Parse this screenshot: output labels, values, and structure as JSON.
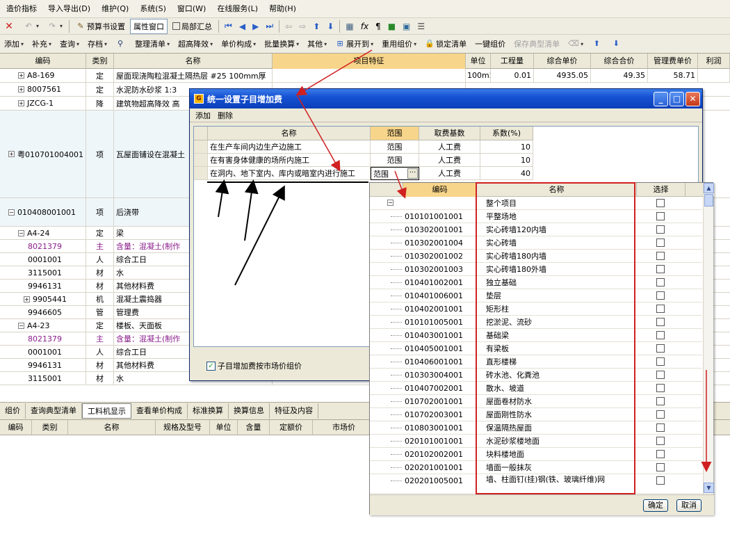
{
  "menu": [
    "造价指标",
    "导入导出(D)",
    "维护(Q)",
    "系统(S)",
    "窗口(W)",
    "在线服务(L)",
    "帮助(H)"
  ],
  "toolbar1": {
    "budget_settings": "预算书设置",
    "property_window": "属性窗口",
    "local_summary": "局部汇总"
  },
  "toolbar2": {
    "add": "添加",
    "supplement": "补充",
    "query": "查询",
    "store": "存档",
    "organize_list": "整理清单",
    "super_height": "超高降效",
    "unit_price_comp": "单价构成",
    "batch_convert": "批量换算",
    "other": "其他",
    "expand_to": "展开到",
    "reuse_price": "重用组价",
    "lock_list": "锁定清单",
    "one_key_price": "一键组价",
    "save_typical": "保存典型清单"
  },
  "main_grid": {
    "headers": [
      "编码",
      "类别",
      "名称",
      "项目特征",
      "单位",
      "工程量",
      "综合单价",
      "综合合价",
      "管理费单价",
      "利润"
    ],
    "rows": [
      {
        "code": "A8-169",
        "type": "定",
        "name": "屋面现浇陶粒混凝土隔热层 #25 100mm厚",
        "unit": "100m2",
        "qty": "0.01",
        "price": "4935.05",
        "total": "49.35",
        "mgmt": "58.71"
      },
      {
        "code": "8007561",
        "type": "定",
        "name": "水泥防水砂浆 1:3",
        "unit": "",
        "qty": "",
        "price": "",
        "total": "",
        "mgmt": ""
      },
      {
        "code": "JZCG-1",
        "type": "降",
        "name": "建筑物超高降效 高",
        "unit": "",
        "qty": "",
        "price": "",
        "total": "",
        "mgmt": ""
      },
      {
        "code": "粤010701004001",
        "type": "项",
        "name": "瓦屋面铺设在混凝土",
        "unit": "",
        "qty": "",
        "price": "",
        "total": "",
        "mgmt": ""
      },
      {
        "code": "010408001001",
        "type": "项",
        "name": "后浇带",
        "unit": "",
        "qty": "",
        "price": "",
        "total": "",
        "mgmt": ""
      },
      {
        "code": "A4-24",
        "type": "定",
        "name": "梁",
        "unit": "",
        "qty": "",
        "price": "",
        "total": "",
        "mgmt": ""
      },
      {
        "code": "8021379",
        "type": "主",
        "name": "含量：混凝土(制作",
        "unit": "",
        "qty": "",
        "price": "",
        "total": "",
        "mgmt": ""
      },
      {
        "code": "0001001",
        "type": "人",
        "name": "综合工日",
        "unit": "",
        "qty": "",
        "price": "",
        "total": "",
        "mgmt": ""
      },
      {
        "code": "3115001",
        "type": "材",
        "name": "水",
        "unit": "",
        "qty": "",
        "price": "",
        "total": "",
        "mgmt": ""
      },
      {
        "code": "9946131",
        "type": "材",
        "name": "其他材料费",
        "unit": "",
        "qty": "",
        "price": "",
        "total": "",
        "mgmt": ""
      },
      {
        "code": "9905441",
        "type": "机",
        "name": "混凝土震捣器",
        "unit": "",
        "qty": "",
        "price": "",
        "total": "",
        "mgmt": ""
      },
      {
        "code": "9946605",
        "type": "管",
        "name": "管理费",
        "unit": "",
        "qty": "",
        "price": "",
        "total": "",
        "mgmt": ""
      },
      {
        "code": "A4-23",
        "type": "定",
        "name": "楼板、天面板",
        "unit": "",
        "qty": "",
        "price": "",
        "total": "",
        "mgmt": ""
      },
      {
        "code": "8021379",
        "type": "主",
        "name": "含量：混凝土(制作",
        "unit": "",
        "qty": "",
        "price": "",
        "total": "",
        "mgmt": ""
      },
      {
        "code": "0001001",
        "type": "人",
        "name": "综合工日",
        "unit": "",
        "qty": "",
        "price": "",
        "total": "",
        "mgmt": ""
      },
      {
        "code": "9946131",
        "type": "材",
        "name": "其他材料费",
        "unit": "",
        "qty": "",
        "price": "",
        "total": "",
        "mgmt": ""
      },
      {
        "code": "3115001",
        "type": "材",
        "name": "水",
        "unit": "",
        "qty": "",
        "price": "",
        "total": "",
        "mgmt": ""
      }
    ]
  },
  "bottom_tabs": [
    "组价",
    "查询典型清单",
    "工料机显示",
    "查看单价构成",
    "标准换算",
    "换算信息",
    "特征及内容"
  ],
  "bottom_headers": [
    "编码",
    "类别",
    "名称",
    "规格及型号",
    "单位",
    "含量",
    "定额价",
    "市场价"
  ],
  "dialog": {
    "title": "统一设置子目增加费",
    "toolbar": [
      "添加",
      "删除"
    ],
    "headers": [
      "名称",
      "范围",
      "取费基数",
      "系数(%)"
    ],
    "rows": [
      {
        "name": "在生产车间内边生产边施工",
        "scope": "范围",
        "base": "人工费",
        "coef": "10"
      },
      {
        "name": "在有害身体健康的场所内施工",
        "scope": "范围",
        "base": "人工费",
        "coef": "10"
      },
      {
        "name": "在洞内、地下室内、库内或暗室内进行施工",
        "scope": "范围",
        "base": "人工费",
        "coef": "40"
      }
    ],
    "footer_checkbox": "子目增加费按市场价组价"
  },
  "dropdown": {
    "headers": [
      "编码",
      "名称",
      "选择"
    ],
    "root": "整个项目",
    "items": [
      {
        "code": "010101001001",
        "name": "平整场地"
      },
      {
        "code": "010302001001",
        "name": "实心砖墙120内墙"
      },
      {
        "code": "010302001004",
        "name": "实心砖墙"
      },
      {
        "code": "010302001002",
        "name": "实心砖墙180内墙"
      },
      {
        "code": "010302001003",
        "name": "实心砖墙180外墙"
      },
      {
        "code": "010401002001",
        "name": "独立基础"
      },
      {
        "code": "010401006001",
        "name": "垫层"
      },
      {
        "code": "010402001001",
        "name": "矩形柱"
      },
      {
        "code": "010101005001",
        "name": "挖淤泥、流砂"
      },
      {
        "code": "010403001001",
        "name": "基础梁"
      },
      {
        "code": "010405001001",
        "name": "有梁板"
      },
      {
        "code": "010406001001",
        "name": "直形楼梯"
      },
      {
        "code": "010303004001",
        "name": "砖水池、化粪池"
      },
      {
        "code": "010407002001",
        "name": "散水、坡道"
      },
      {
        "code": "010702001001",
        "name": "屋面卷材防水"
      },
      {
        "code": "010702003001",
        "name": "屋面刚性防水"
      },
      {
        "code": "010803001001",
        "name": "保温隔热屋面"
      },
      {
        "code": "020101001001",
        "name": "水泥砂浆楼地面"
      },
      {
        "code": "020102002001",
        "name": "块料楼地面"
      },
      {
        "code": "020201001001",
        "name": "墙面一般抹灰"
      },
      {
        "code": "020201005001",
        "name": "墙、柱面钉(挂)钢(铁、玻璃纤维)网"
      }
    ],
    "ok": "确定",
    "cancel": "取消"
  },
  "colors": {
    "title_bar": "#1652d4",
    "annotation_red": "#d02020",
    "main_item_purple": "#8a1c8a"
  }
}
